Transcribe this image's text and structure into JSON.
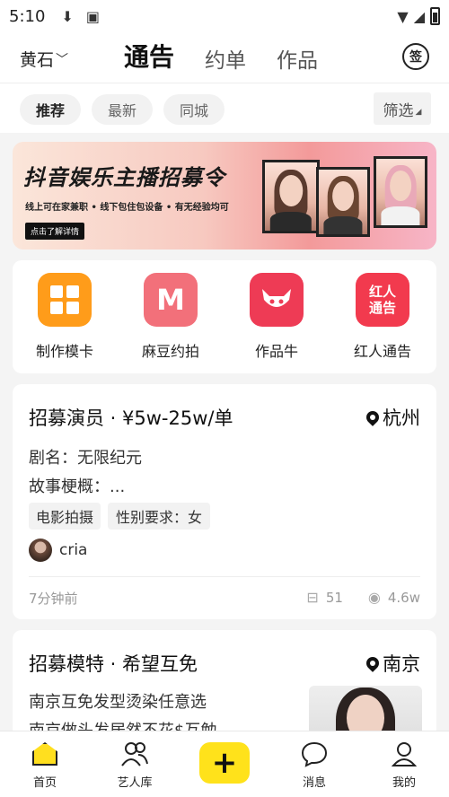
{
  "status_bar": {
    "time": "5:10"
  },
  "header": {
    "city": "黄石",
    "tabs": [
      "通告",
      "约单",
      "作品"
    ],
    "sign_label": "签"
  },
  "filters": {
    "chips": [
      "推荐",
      "最新",
      "同城"
    ],
    "filter_label": "筛选"
  },
  "banner": {
    "title": "抖音娱乐主播招募令",
    "subtitle": "线上可在家兼职 • 线下包住包设备 • 有无经验均可",
    "cta": "点击了解详情"
  },
  "quick_actions": [
    {
      "label": "制作模卡",
      "icon": "grid-icon",
      "color": "#ff9c1a"
    },
    {
      "label": "麻豆约拍",
      "icon": "m-logo-icon",
      "color": "#f2707a",
      "glyph": "M"
    },
    {
      "label": "作品牛",
      "icon": "bull-logo-icon",
      "color": "#ee3b55"
    },
    {
      "label": "红人通告",
      "icon": "hongren-logo-icon",
      "color": "#f23a4e",
      "glyph_line1": "红人",
      "glyph_line2": "通告"
    }
  ],
  "posts": [
    {
      "title": "招募演员 · ¥5w-25w/单",
      "location": "杭州",
      "line1": "剧名：无限纪元",
      "line2": "故事梗概：...",
      "tags": [
        "电影拍摄",
        "性别要求：女"
      ],
      "author": "cria",
      "time_ago": "7分钟前",
      "applies": "51",
      "views": "4.6w"
    },
    {
      "title": "招募模特 · 希望互免",
      "location": "南京",
      "line1": "南京互免发型烫染任意选",
      "line2": "南京做头发居然不花$互勉"
    }
  ],
  "bottom_nav": [
    "首页",
    "艺人库",
    "消息",
    "我的"
  ],
  "colors": {
    "accent": "#ffe21b"
  }
}
